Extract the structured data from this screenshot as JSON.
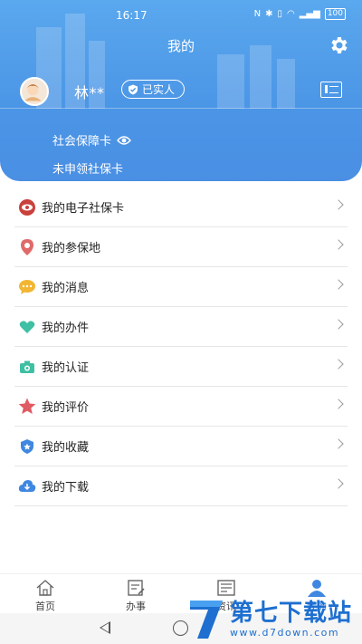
{
  "status_bar": {
    "time": "16:17",
    "battery": "100"
  },
  "header": {
    "title": "我的",
    "username": "林**",
    "verified_label": "已实人",
    "card_label": "社会保障卡",
    "card_status": "未申领社保卡"
  },
  "menu": {
    "items": [
      {
        "label": "我的电子社保卡",
        "icon": "social-security-card-icon",
        "color": "#c9413c"
      },
      {
        "label": "我的参保地",
        "icon": "location-pin-icon",
        "color": "#e06a6a"
      },
      {
        "label": "我的消息",
        "icon": "message-icon",
        "color": "#f2b632"
      },
      {
        "label": "我的办件",
        "icon": "heart-icon",
        "color": "#3fbfa3"
      },
      {
        "label": "我的认证",
        "icon": "camera-icon",
        "color": "#3fbfa3"
      },
      {
        "label": "我的评价",
        "icon": "star-icon",
        "color": "#e05a62"
      },
      {
        "label": "我的收藏",
        "icon": "shield-star-icon",
        "color": "#3f87e0"
      },
      {
        "label": "我的下载",
        "icon": "cloud-download-icon",
        "color": "#3f87e0"
      }
    ]
  },
  "bottom_nav": {
    "items": [
      {
        "label": "首页",
        "icon": "home-icon"
      },
      {
        "label": "办事",
        "icon": "document-edit-icon"
      },
      {
        "label": "资讯",
        "icon": "news-icon"
      },
      {
        "label": "我的",
        "icon": "user-icon",
        "active": true
      }
    ]
  },
  "watermark": {
    "name": "第七下载站",
    "url": "www.d7down.com"
  }
}
